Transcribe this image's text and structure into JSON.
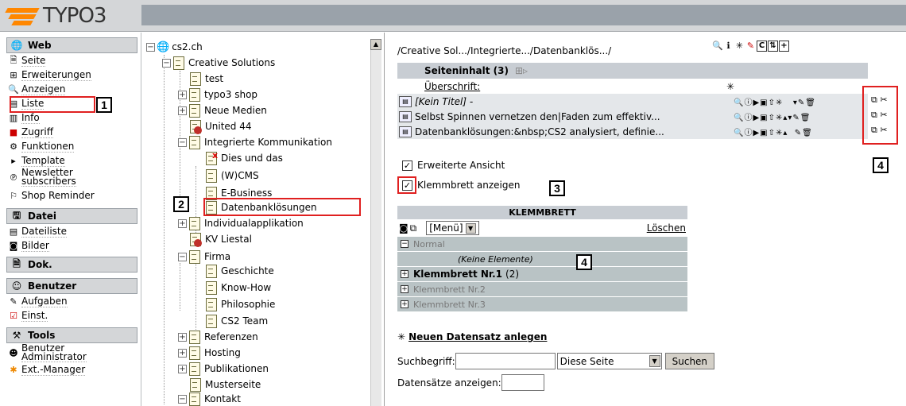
{
  "app": {
    "logo_text": "TYPO3",
    "brand_color": "#ff8700"
  },
  "menu": {
    "groups": [
      {
        "label": "Web",
        "icon": "globe-icon",
        "items": [
          {
            "label": "Seite",
            "icon": "page-icon"
          },
          {
            "label": "Erweiterungen",
            "icon": "extensions-icon"
          },
          {
            "label": "Anzeigen",
            "icon": "magnifier-icon"
          },
          {
            "label": "Liste",
            "icon": "list-icon"
          },
          {
            "label": "Info",
            "icon": "info-icon"
          },
          {
            "label": "Zugriff",
            "icon": "access-icon"
          },
          {
            "label": "Funktionen",
            "icon": "functions-icon"
          },
          {
            "label": "Template",
            "icon": "template-icon"
          },
          {
            "label": "Newsletter subscribers",
            "label_line1": "Newsletter",
            "label_line2": "subscribers",
            "icon": "newsletter-icon"
          },
          {
            "label": "Shop Reminder",
            "icon": "shop-icon"
          }
        ]
      },
      {
        "label": "Datei",
        "icon": "file-icon",
        "items": [
          {
            "label": "Dateiliste",
            "icon": "filelist-icon"
          },
          {
            "label": "Bilder",
            "icon": "camera-icon"
          }
        ]
      },
      {
        "label": "Dok.",
        "icon": "doc-icon",
        "items": []
      },
      {
        "label": "Benutzer",
        "icon": "user-icon",
        "items": [
          {
            "label": "Aufgaben",
            "icon": "tasks-icon"
          },
          {
            "label": "Einst.",
            "icon": "settings-check-icon"
          }
        ]
      },
      {
        "label": "Tools",
        "icon": "tools-icon",
        "items": [
          {
            "label": "Benutzer Administrator",
            "label_line1": "Benutzer",
            "label_line2": "Administrator",
            "icon": "useradmin-icon"
          },
          {
            "label": "Ext.-Manager",
            "icon": "extmanager-icon"
          }
        ]
      }
    ]
  },
  "tree": {
    "root": "cs2.ch",
    "nodes": [
      {
        "label": "Creative Solutions"
      },
      {
        "label": "test"
      },
      {
        "label": "typo3 shop"
      },
      {
        "label": "Neue Medien"
      },
      {
        "label": "United 44"
      },
      {
        "label": "Integrierte Kommunikation"
      },
      {
        "label": "Dies und das"
      },
      {
        "label": "(W)CMS"
      },
      {
        "label": "E-Business"
      },
      {
        "label": "Datenbanklösungen"
      },
      {
        "label": "Individualapplikation"
      },
      {
        "label": "KV Liestal"
      },
      {
        "label": "Firma"
      },
      {
        "label": "Geschichte"
      },
      {
        "label": "Know-How"
      },
      {
        "label": "Philosophie"
      },
      {
        "label": "CS2 Team"
      },
      {
        "label": "Referenzen"
      },
      {
        "label": "Hosting"
      },
      {
        "label": "Publikationen"
      },
      {
        "label": "Musterseite"
      },
      {
        "label": "Kontakt"
      }
    ]
  },
  "main": {
    "path": "/Creative Sol.../Integrierte.../Datenbanklös.../",
    "table_title": "Seiteninhalt (3)",
    "column_header": "Überschrift:",
    "rows": [
      {
        "title": "[Kein Titel] -"
      },
      {
        "title": "Selbst Spinnen vernetzen den|Faden zum effektiv..."
      },
      {
        "title": "Datenbanklösungen:&nbsp;CS2 analysiert, definie..."
      }
    ],
    "erweiterte_ansicht": "Erweiterte Ansicht",
    "klemmbrett_anzeigen": "Klemmbrett anzeigen",
    "clipboard": {
      "title": "KLEMMBRETT",
      "menu_select": "[Menü]",
      "clear_label": "Löschen",
      "pads": [
        {
          "label": "Normal",
          "expander": "−"
        },
        {
          "label": "Klemmbrett Nr.1",
          "count": "(2)",
          "expander": "+"
        },
        {
          "label": "Klemmbrett Nr.2",
          "expander": "+"
        },
        {
          "label": "Klemmbrett Nr.3",
          "expander": "+"
        }
      ],
      "empty_label": "(Keine Elemente)"
    },
    "new_record": "Neuen Datensatz anlegen",
    "search": {
      "label": "Suchbegriff:",
      "scope": "Diese Seite",
      "button": "Suchen"
    },
    "show_records": "Datensätze anzeigen:"
  },
  "annotations": [
    "1",
    "2",
    "3",
    "4",
    "4"
  ],
  "annotation_color": "#e02020"
}
